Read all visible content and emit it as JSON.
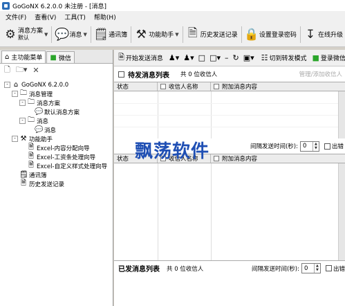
{
  "window": {
    "title": "GoGoNX 6.2.0.0  未注册 - [消息]"
  },
  "menu": [
    "文件(F)",
    "查看(V)",
    "工具(T)",
    "帮助(H)"
  ],
  "toolbar": {
    "scheme_label": "消息方案",
    "scheme_sub": "默认",
    "message_label": "消息",
    "contacts_label": "通讯簿",
    "assistant_label": "功能助手",
    "history_label": "历史发送记录",
    "password_label": "设置登录密码",
    "upgrade_label": "在线升级"
  },
  "left": {
    "tab_main": "主功能菜单",
    "tab_wechat": "微信",
    "tree": [
      {
        "level": 0,
        "icon": "home-icon",
        "label": "GoGoNX 6.2.0.0",
        "expander": "-"
      },
      {
        "level": 1,
        "icon": "folder-icon",
        "label": "消息管理",
        "expander": "-"
      },
      {
        "level": 2,
        "icon": "folder-icon",
        "label": "消息方案",
        "expander": "-"
      },
      {
        "level": 3,
        "icon": "chat-icon",
        "label": "默认消息方案",
        "expander": ""
      },
      {
        "level": 2,
        "icon": "folder-icon",
        "label": "消息",
        "expander": "-"
      },
      {
        "level": 3,
        "icon": "chat-icon",
        "label": "消息",
        "expander": ""
      },
      {
        "level": 1,
        "icon": "tools-icon",
        "label": "功能助手",
        "expander": "-"
      },
      {
        "level": 2,
        "icon": "excel-icon",
        "label": "Excel-内容分配向导",
        "expander": ""
      },
      {
        "level": 2,
        "icon": "excel-icon",
        "label": "Excel-工资条处理向导",
        "expander": ""
      },
      {
        "level": 2,
        "icon": "excel-icon",
        "label": "Excel-自定义样式处理向导",
        "expander": ""
      },
      {
        "level": 1,
        "icon": "contacts-icon",
        "label": "通讯簿",
        "expander": ""
      },
      {
        "level": 1,
        "icon": "history-icon",
        "label": "历史发送记录",
        "expander": ""
      }
    ]
  },
  "right": {
    "toolbar": {
      "start_send": "开始发送消息",
      "switch_mode": "切到转发模式",
      "wechat_login": "登录微信"
    },
    "pending": {
      "title": "待发消息列表",
      "count": "共 0 位收信人",
      "link": "管理/添加收信人"
    },
    "columns": {
      "status": "状态",
      "recipient": "收信人名称",
      "attach": "附加消息内容"
    },
    "interval": {
      "label": "间隔发送时间(秒):",
      "value": "0",
      "check_label": "出错"
    },
    "sent": {
      "title": "已发消息列表",
      "count": "共 0 位收信人"
    }
  },
  "watermark": "飘荡软件"
}
